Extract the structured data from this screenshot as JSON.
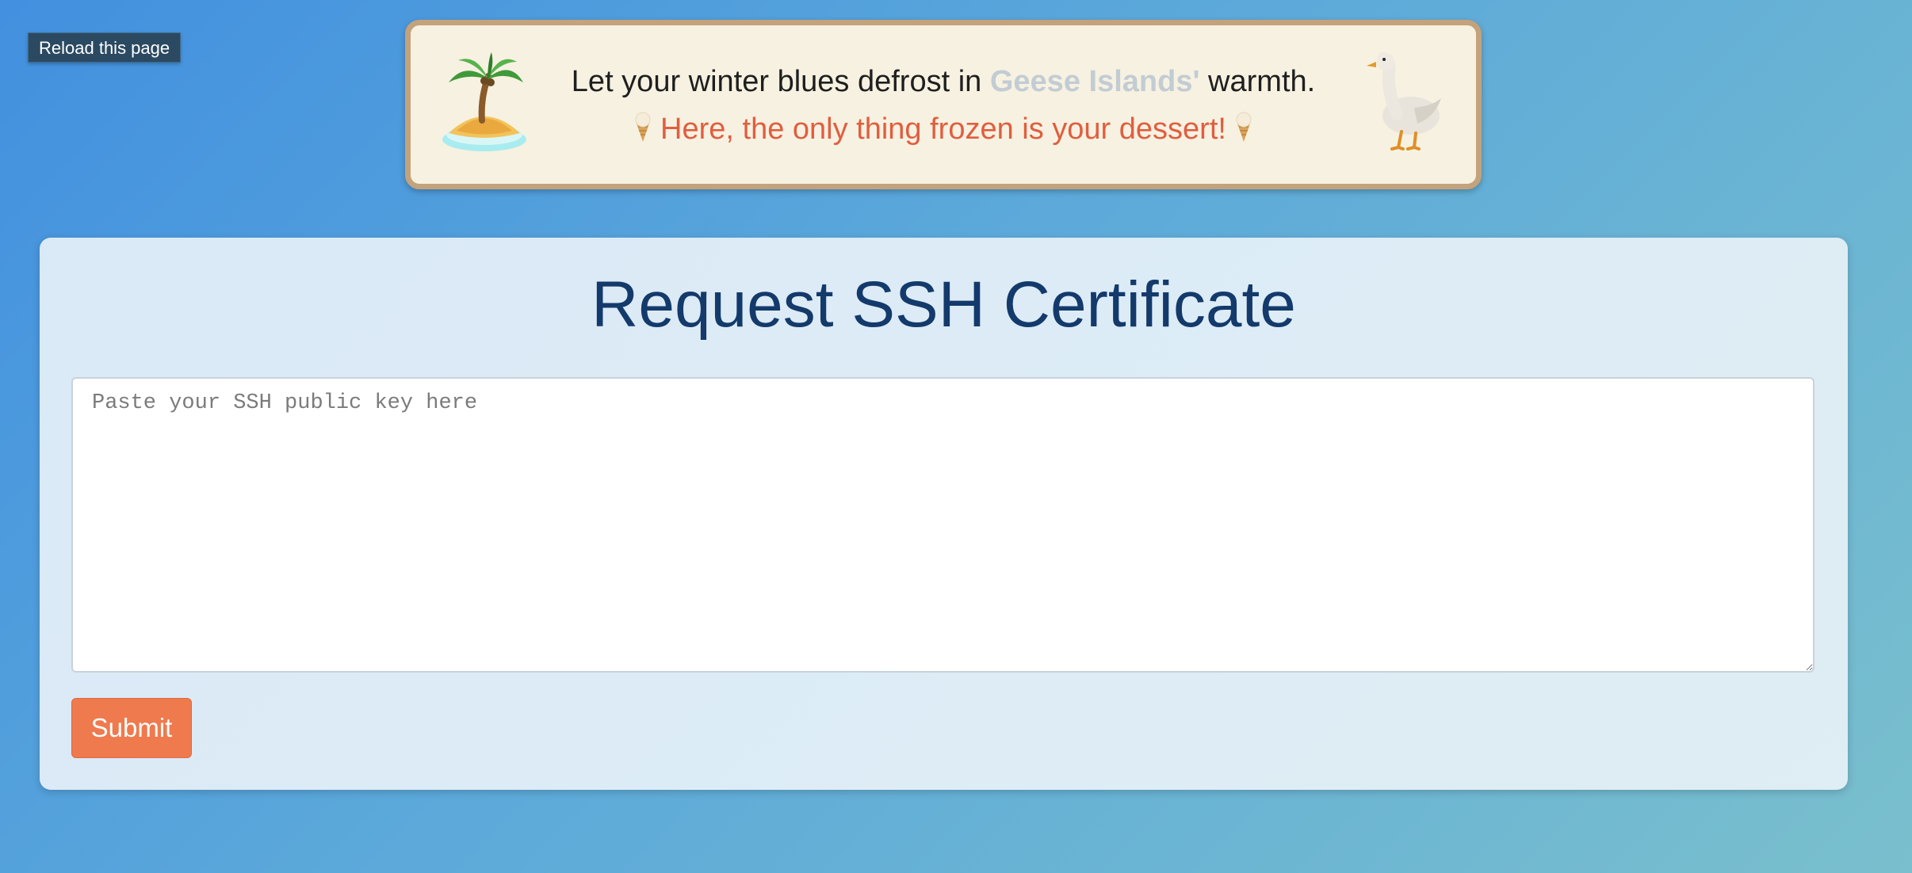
{
  "reload": {
    "label": "Reload this page"
  },
  "banner": {
    "line1_before": "Let your winter blues defrost in ",
    "line1_highlight": "Geese Islands'",
    "line1_after": " warmth.",
    "line2": "Here, the only thing frozen is your dessert!",
    "left_icon": "desert-island-icon",
    "right_icon": "goose-icon",
    "decor_icon": "ice-cream-cone-icon"
  },
  "form": {
    "title": "Request SSH Certificate",
    "textarea_placeholder": "Paste your SSH public key here",
    "textarea_value": "",
    "submit_label": "Submit"
  },
  "colors": {
    "title": "#133a6b",
    "submit_bg": "#ef7a4d",
    "banner_bg": "#f7f1e1",
    "banner_border": "#c3a27c",
    "line2_text": "#e05e3f",
    "highlight_text": "#c2ccd3"
  }
}
